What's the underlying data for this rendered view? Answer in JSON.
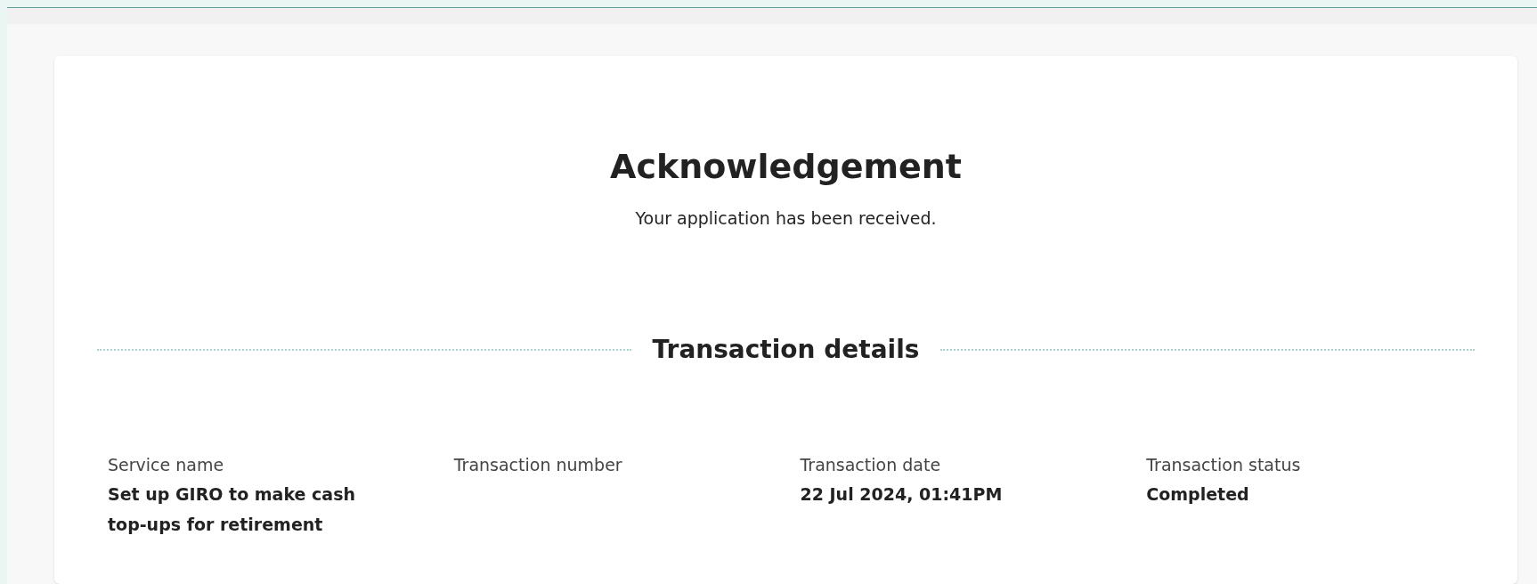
{
  "title": "Acknowledgement",
  "subtitle": "Your application has been received.",
  "section": {
    "heading": "Transaction details",
    "fields": [
      {
        "label": "Service name",
        "value": "Set up GIRO to make cash top-ups for retirement"
      },
      {
        "label": "Transaction number"
      },
      {
        "label": "Transaction date",
        "value": "22 Jul 2024, 01:41PM"
      },
      {
        "label": "Transaction status",
        "value": "Completed"
      }
    ]
  }
}
